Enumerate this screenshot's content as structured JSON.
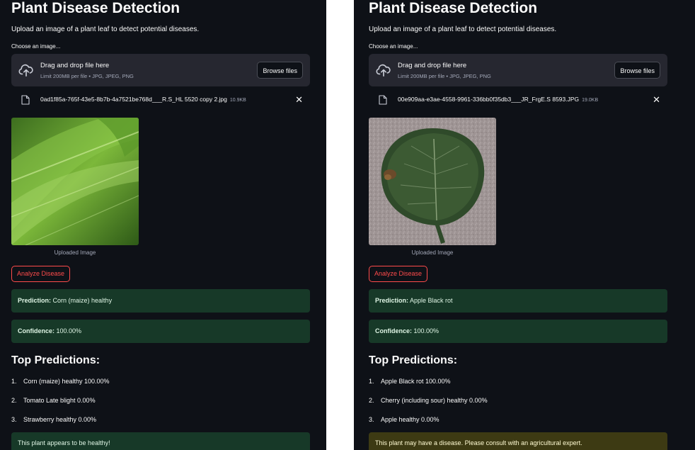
{
  "panels": [
    {
      "title": "Plant Disease Detection",
      "subtitle": "Upload an image of a plant leaf to detect potential diseases.",
      "uploader_label": "Choose an image...",
      "dropzone": {
        "main": "Drag and drop file here",
        "sub": "Limit 200MB per file • JPG, JPEG, PNG",
        "browse": "Browse files"
      },
      "file": {
        "name": "0ad1f85a-765f-43e5-8b7b-4a7521be768d___R.S_HL 5520 copy 2.jpg",
        "size": "10.9KB"
      },
      "caption": "Uploaded Image",
      "analyze": "Analyze Disease",
      "prediction": {
        "label": "Prediction:",
        "value": "Corn (maize) healthy"
      },
      "confidence": {
        "label": "Confidence:",
        "value": "100.00%"
      },
      "top_title": "Top Predictions:",
      "top": [
        {
          "num": "1.",
          "text": "Corn (maize) healthy 100.00%"
        },
        {
          "num": "2.",
          "text": "Tomato Late blight 0.00%"
        },
        {
          "num": "3.",
          "text": "Strawberry healthy 0.00%"
        }
      ],
      "final": "This plant appears to be healthy!"
    },
    {
      "title": "Plant Disease Detection",
      "subtitle": "Upload an image of a plant leaf to detect potential diseases.",
      "uploader_label": "Choose an image...",
      "dropzone": {
        "main": "Drag and drop file here",
        "sub": "Limit 200MB per file • JPG, JPEG, PNG",
        "browse": "Browse files"
      },
      "file": {
        "name": "00e909aa-e3ae-4558-9961-336bb0f35db3___JR_FrgE.S 8593.JPG",
        "size": "19.0KB"
      },
      "caption": "Uploaded Image",
      "analyze": "Analyze Disease",
      "prediction": {
        "label": "Prediction:",
        "value": "Apple Black rot"
      },
      "confidence": {
        "label": "Confidence:",
        "value": "100.00%"
      },
      "top_title": "Top Predictions:",
      "top": [
        {
          "num": "1.",
          "text": "Apple Black rot 100.00%"
        },
        {
          "num": "2.",
          "text": "Cherry (including sour) healthy 0.00%"
        },
        {
          "num": "3.",
          "text": "Apple healthy 0.00%"
        }
      ],
      "final": "This plant may have a disease. Please consult with an agricultural expert."
    }
  ],
  "icons": {
    "upload": "cloud-upload-icon",
    "file": "file-icon",
    "close": "close-icon"
  },
  "colors": {
    "background": "#0e1117",
    "dropzone": "#262730",
    "accent": "#ff4b4b",
    "success": "#173928",
    "warning": "#3d3a13"
  }
}
